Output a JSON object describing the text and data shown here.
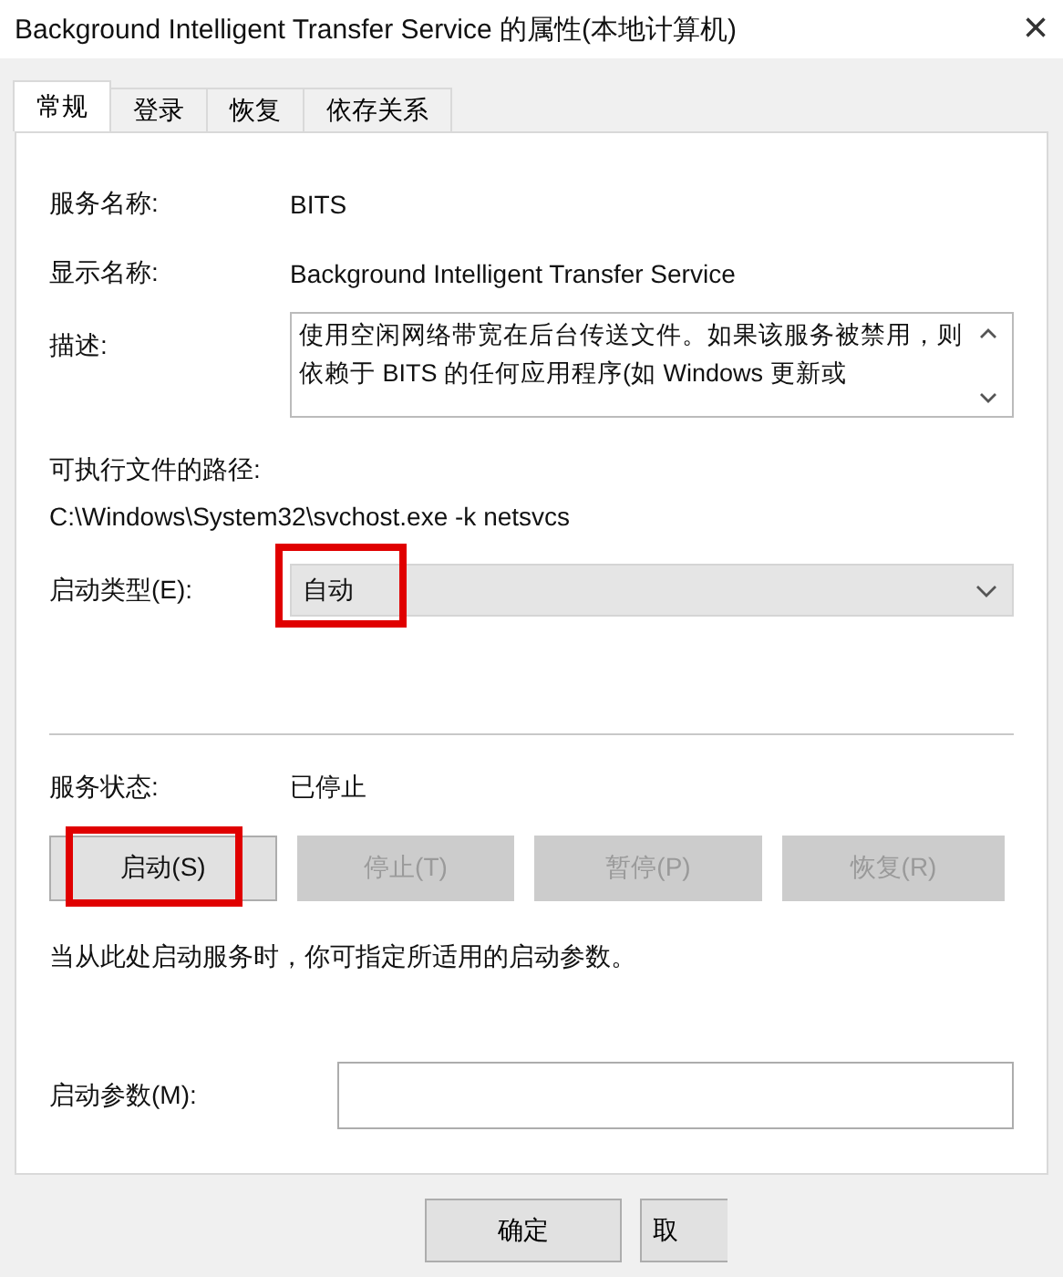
{
  "window": {
    "title": "Background Intelligent Transfer Service 的属性(本地计算机)",
    "close": "×"
  },
  "tabs": [
    {
      "label": "常规",
      "selected": true
    },
    {
      "label": "登录",
      "selected": false
    },
    {
      "label": "恢复",
      "selected": false
    },
    {
      "label": "依存关系",
      "selected": false
    }
  ],
  "service_name": {
    "label": "服务名称:",
    "value": "BITS"
  },
  "display_name": {
    "label": "显示名称:",
    "value": "Background Intelligent Transfer Service"
  },
  "description": {
    "label": "描述:",
    "value": "使用空闲网络带宽在后台传送文件。如果该服务被禁用，则依赖于 BITS 的任何应用程序(如 Windows 更新或"
  },
  "executable_path": {
    "label": "可执行文件的路径:",
    "value": "C:\\Windows\\System32\\svchost.exe -k netsvcs"
  },
  "startup_type": {
    "label": "启动类型(E):",
    "value": "自动",
    "highlighted": true
  },
  "service_status": {
    "label": "服务状态:",
    "value": "已停止"
  },
  "service_buttons": [
    {
      "label": "启动(S)",
      "disabled": false,
      "highlighted": true
    },
    {
      "label": "停止(T)",
      "disabled": true,
      "highlighted": false
    },
    {
      "label": "暂停(P)",
      "disabled": true,
      "highlighted": false
    },
    {
      "label": "恢复(R)",
      "disabled": true,
      "highlighted": false
    }
  ],
  "note": "当从此处启动服务时，你可指定所适用的启动参数。",
  "start_parameters": {
    "label": "启动参数(M):"
  },
  "dialog_buttons": [
    "确定",
    "取"
  ]
}
